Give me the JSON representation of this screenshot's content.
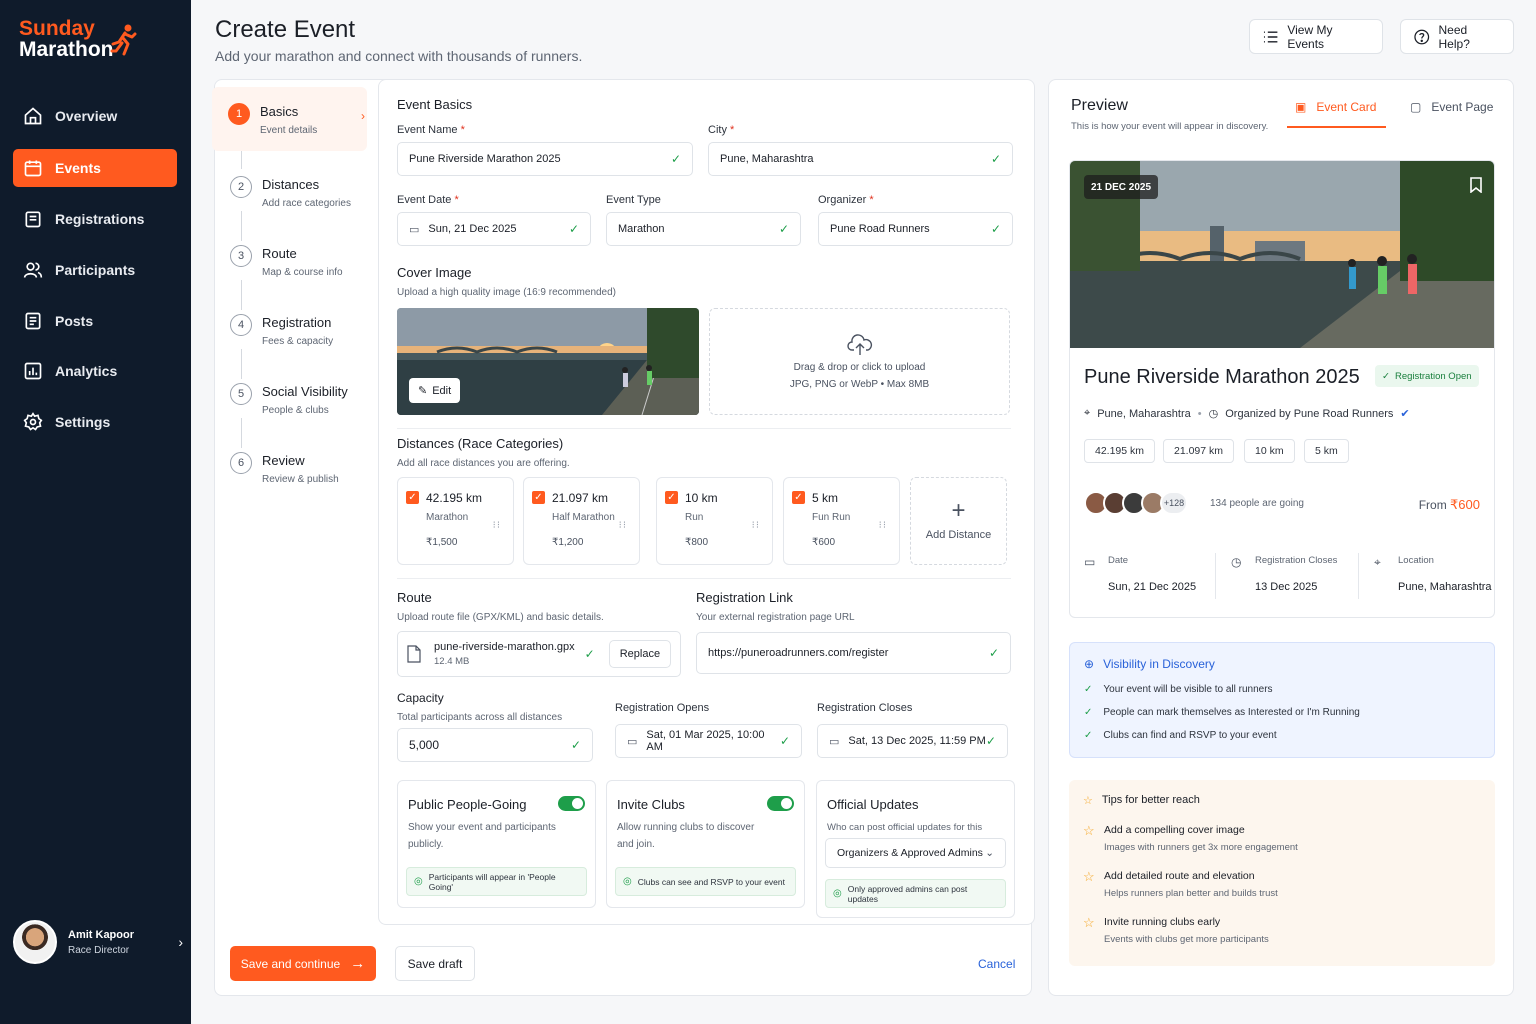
{
  "brand": {
    "line1": "Sunday",
    "line2": "Marathon",
    "accent": "#ff5a1f"
  },
  "nav": [
    {
      "label": "Overview",
      "icon": "home-icon",
      "active": false
    },
    {
      "label": "Events",
      "icon": "calendar-icon",
      "active": true
    },
    {
      "label": "Registrations",
      "icon": "clipboard-icon",
      "active": false
    },
    {
      "label": "Participants",
      "icon": "users-icon",
      "active": false
    },
    {
      "label": "Posts",
      "icon": "document-icon",
      "active": false
    },
    {
      "label": "Analytics",
      "icon": "chart-icon",
      "active": false
    },
    {
      "label": "Settings",
      "icon": "gear-icon",
      "active": false
    }
  ],
  "user": {
    "name": "Amit Kapoor",
    "role": "Race Director"
  },
  "header": {
    "title": "Create Event",
    "subtitle": "Add your marathon and connect with thousands of runners.",
    "view_events": "View My Events",
    "help": "Need Help?"
  },
  "steps": [
    {
      "num": "1",
      "name": "Basics",
      "desc": "Event details"
    },
    {
      "num": "2",
      "name": "Distances",
      "desc": "Add race categories"
    },
    {
      "num": "3",
      "name": "Route",
      "desc": "Map & course info"
    },
    {
      "num": "4",
      "name": "Registration",
      "desc": "Fees & capacity"
    },
    {
      "num": "5",
      "name": "Social Visibility",
      "desc": "People & clubs"
    },
    {
      "num": "6",
      "name": "Review",
      "desc": "Review & publish"
    }
  ],
  "form": {
    "section_title": "Event Basics",
    "event_name_label": "Event Name",
    "event_name": "Pune Riverside Marathon 2025",
    "city_label": "City",
    "city": "Pune, Maharashtra",
    "event_date_label": "Event Date",
    "event_date": "Sun, 21 Dec 2025",
    "event_type_label": "Event Type",
    "event_type": "Marathon",
    "organizer_label": "Organizer",
    "organizer": "Pune Road Runners",
    "cover_title": "Cover Image",
    "cover_hint": "Upload a high quality image (16:9 recommended)",
    "edit_label": "Edit",
    "upload_text": "Drag & drop or click to upload",
    "upload_formats": "JPG, PNG or WebP • Max 8MB",
    "distances_title": "Distances (Race Categories)",
    "distances_hint": "Add all race distances you are offering.",
    "distances": [
      {
        "km": "42.195 km",
        "kind": "Marathon",
        "price": "₹1,500"
      },
      {
        "km": "21.097 km",
        "kind": "Half Marathon",
        "price": "₹1,200"
      },
      {
        "km": "10 km",
        "kind": "Run",
        "price": "₹800"
      },
      {
        "km": "5 km",
        "kind": "Fun Run",
        "price": "₹600"
      }
    ],
    "add_distance": "Add Distance",
    "route_title": "Route",
    "route_hint": "Upload route file (GPX/KML) and basic details.",
    "route_file": "pune-riverside-marathon.gpx",
    "route_size": "12.4 MB",
    "replace_label": "Replace",
    "reglink_title": "Registration Link",
    "reglink_hint": "Your external registration page URL",
    "reglink": "https://puneroadrunners.com/register",
    "capacity_title": "Capacity",
    "capacity_hint": "Total participants across all distances",
    "capacity": "5,000",
    "reg_opens_label": "Registration Opens",
    "reg_opens": "Sat, 01 Mar 2025, 10:00 AM",
    "reg_closes_label": "Registration Closes",
    "reg_closes": "Sat, 13 Dec 2025, 11:59 PM",
    "public_title": "Public People-Going",
    "public_desc": "Show your event and participants publicly.",
    "public_note": "Participants will appear in 'People Going'",
    "clubs_title": "Invite Clubs",
    "clubs_desc": "Allow running clubs to discover and join.",
    "clubs_note": "Clubs can see and RSVP to your event",
    "updates_title": "Official Updates",
    "updates_desc": "Who can post official updates for this event?",
    "updates_select": "Organizers & Approved Admins",
    "updates_note": "Only approved admins can post updates",
    "save_continue": "Save and continue",
    "save_draft": "Save draft",
    "cancel": "Cancel"
  },
  "preview": {
    "title": "Preview",
    "subtitle": "This is how your event will appear in discovery.",
    "tab_card": "Event Card",
    "tab_page": "Event Page",
    "date_badge": "21 DEC 2025",
    "event_name": "Pune Riverside Marathon 2025",
    "status": "Registration Open",
    "location": "Pune, Maharashtra",
    "organized_by": "Organized by Pune Road Runners",
    "chips": [
      "42.195 km",
      "21.097 km",
      "10 km",
      "5 km"
    ],
    "avatar_more": "+128",
    "going": "134 people are going",
    "from_label": "From",
    "from_price": "₹600",
    "info": [
      {
        "k": "Date",
        "v": "Sun, 21 Dec 2025"
      },
      {
        "k": "Registration Closes",
        "v": "13 Dec 2025"
      },
      {
        "k": "Location",
        "v": "Pune, Maharashtra"
      }
    ],
    "visibility_title": "Visibility in Discovery",
    "visibility_items": [
      "Your event will be visible to all runners",
      "People can mark themselves as Interested or I'm Running",
      "Clubs can find and RSVP to your event"
    ],
    "tips_title": "Tips for better reach",
    "tips": [
      {
        "t": "Add a compelling cover image",
        "d": "Images with runners get 3x more engagement"
      },
      {
        "t": "Add detailed route and elevation",
        "d": "Helps runners plan better and builds trust"
      },
      {
        "t": "Invite running clubs early",
        "d": "Events with clubs get more participants"
      }
    ]
  }
}
